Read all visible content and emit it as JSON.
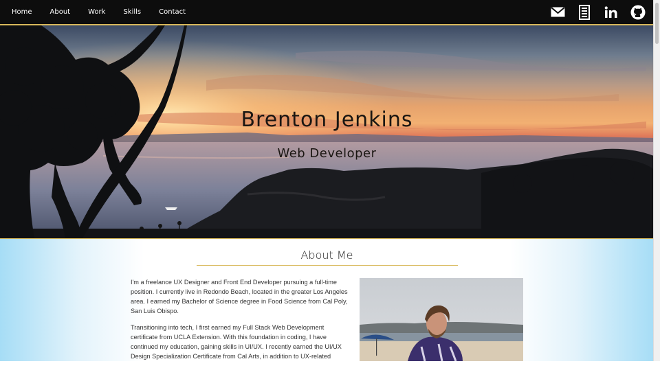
{
  "nav": {
    "links": [
      "Home",
      "About",
      "Work",
      "Skills",
      "Contact"
    ],
    "icons": [
      "mail-icon",
      "resume-icon",
      "linkedin-icon",
      "github-icon"
    ]
  },
  "hero": {
    "title": "Brenton Jenkins",
    "subtitle": "Web Developer"
  },
  "about": {
    "title": "About Me",
    "paragraphs": [
      "I'm a freelance UX Designer and Front End Developer pursuing a full-time position. I currently live in Redondo Beach, located in the greater Los Angeles area. I earned my Bachelor of Science degree in Food Science from Cal Poly, San Luis Obispo.",
      "Transitioning into tech, I first earned my Full Stack Web Development certificate from UCLA Extension. With this foundation in coding, I have continued my education, gaining skills in UI/UX. I recently earned the UI/UX Design Specialization Certificate from Cal Arts, in addition to UX-related"
    ]
  },
  "colors": {
    "nav_bg": "#0d0d0d",
    "accent": "#d8b85a",
    "side_gradient": "#a6ddf6"
  }
}
